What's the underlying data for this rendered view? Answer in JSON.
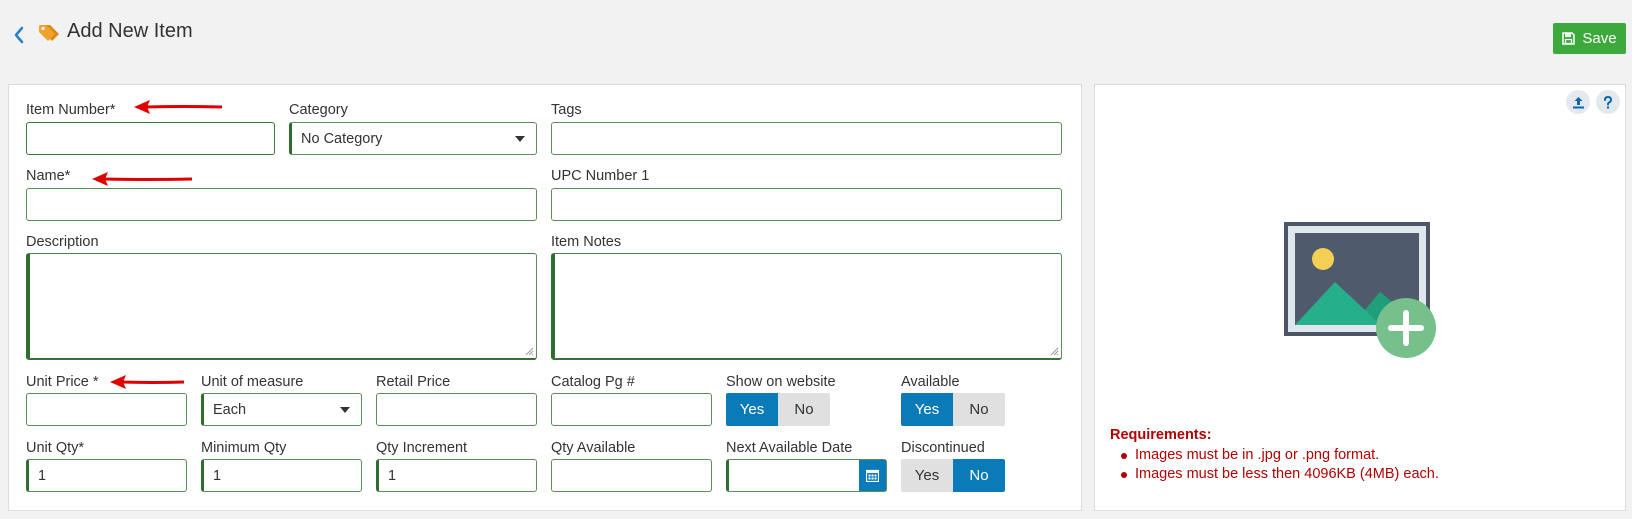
{
  "header": {
    "title": "Add New Item",
    "save_label": "Save"
  },
  "form": {
    "item_number": {
      "label": "Item Number*",
      "value": ""
    },
    "category": {
      "label": "Category",
      "value": "No Category"
    },
    "tags": {
      "label": "Tags",
      "value": ""
    },
    "name": {
      "label": "Name*",
      "value": ""
    },
    "upc": {
      "label": "UPC Number 1",
      "value": ""
    },
    "description": {
      "label": "Description",
      "value": ""
    },
    "item_notes": {
      "label": "Item Notes",
      "value": ""
    },
    "unit_price": {
      "label": "Unit Price *",
      "value": ""
    },
    "unit_of_measure": {
      "label": "Unit of measure",
      "value": "Each"
    },
    "retail_price": {
      "label": "Retail Price",
      "value": ""
    },
    "catalog_pg": {
      "label": "Catalog Pg #",
      "value": ""
    },
    "show_on_website": {
      "label": "Show on website",
      "yes": "Yes",
      "no": "No",
      "selected": "Yes"
    },
    "available": {
      "label": "Available",
      "yes": "Yes",
      "no": "No",
      "selected": "Yes"
    },
    "unit_qty": {
      "label": "Unit Qty*",
      "value": "1"
    },
    "minimum_qty": {
      "label": "Minimum Qty",
      "value": "1"
    },
    "qty_increment": {
      "label": "Qty Increment",
      "value": "1"
    },
    "qty_available": {
      "label": "Qty Available",
      "value": ""
    },
    "next_available_date": {
      "label": "Next Available Date",
      "value": ""
    },
    "discontinued": {
      "label": "Discontinued",
      "yes": "Yes",
      "no": "No",
      "selected": "No"
    }
  },
  "image_panel": {
    "requirements_title": "Requirements:",
    "requirements": [
      "Images must be in .jpg or .png format.",
      "Images must be less then 4096KB (4MB) each."
    ]
  },
  "colors": {
    "accent_blue": "#0b7ab8",
    "save_green": "#3da93d",
    "required_green": "#2f6e2f",
    "error_red": "#b30000",
    "annotation_arrow": "#e00000"
  },
  "icons": [
    "chevron-left-icon",
    "tag-icon",
    "save-icon",
    "upload-icon",
    "help-icon",
    "calendar-icon",
    "image-placeholder-icon",
    "add-circle-icon",
    "red-arrow-annotation"
  ]
}
